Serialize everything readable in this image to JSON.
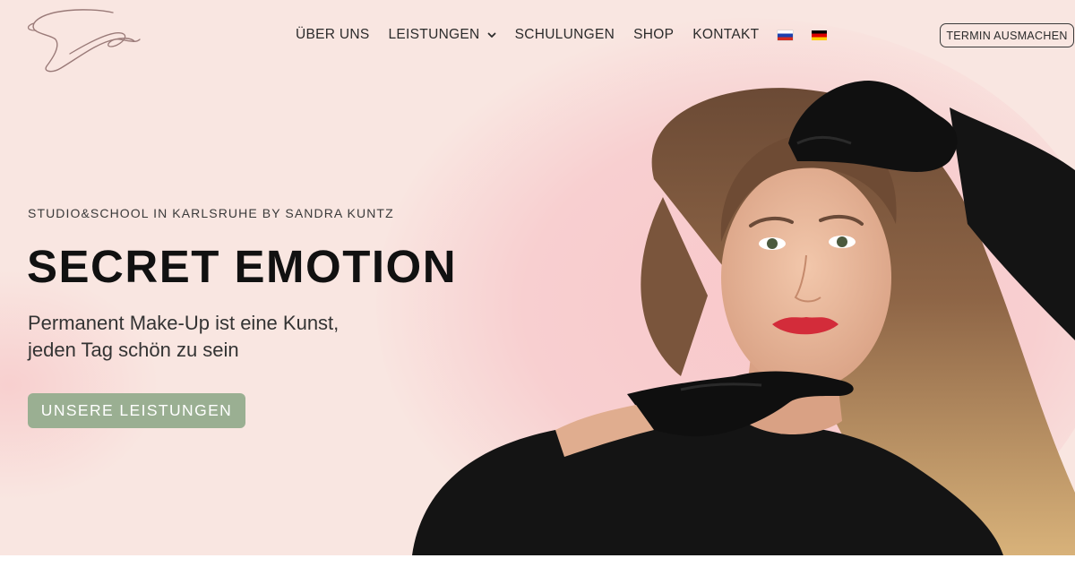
{
  "brand": {
    "logo_alt": "Secret Emotion"
  },
  "nav": {
    "items": [
      {
        "label": "ÜBER UNS"
      },
      {
        "label": "LEISTUNGEN",
        "has_dropdown": true
      },
      {
        "label": "SCHULUNGEN"
      },
      {
        "label": "SHOP"
      },
      {
        "label": "KONTAKT"
      }
    ],
    "languages": [
      "ru",
      "de"
    ]
  },
  "header": {
    "cta_label": "TERMIN AUSMACHEN"
  },
  "hero": {
    "eyebrow": "STUDIO&SCHOOL IN KARLSRUHE BY SANDRA KUNTZ",
    "title": "SECRET EMOTION",
    "subtitle_line1": "Permanent Make-Up ist eine Kunst,",
    "subtitle_line2": "jeden Tag schön zu sein",
    "button_label": "UNSERE LEISTUNGEN"
  },
  "colors": {
    "background": "#f9e6e1",
    "blob": "#f8cfd0",
    "button": "#9aaf92",
    "text": "#111111"
  }
}
